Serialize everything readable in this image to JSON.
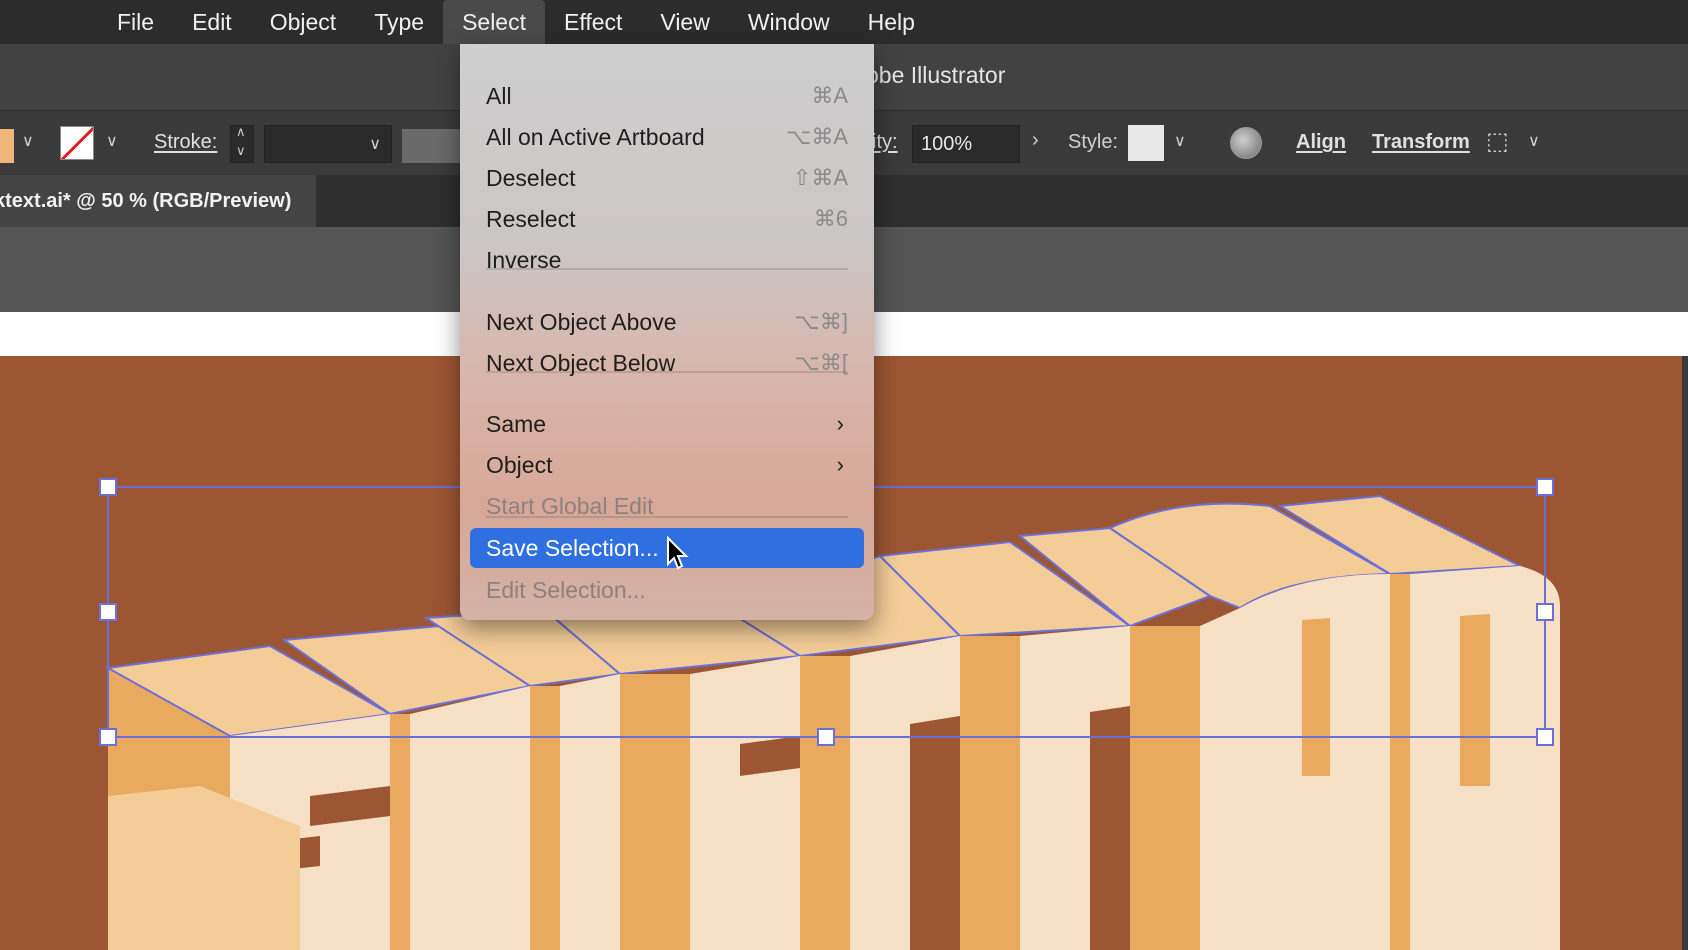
{
  "menubar": {
    "items": [
      "File",
      "Edit",
      "Object",
      "Type",
      "Select",
      "Effect",
      "View",
      "Window",
      "Help"
    ],
    "active": "Select"
  },
  "app": {
    "title": "obe Illustrator"
  },
  "controlbar": {
    "stroke_label": "Stroke:",
    "opacity_label": "ity:",
    "opacity_value": "100%",
    "style_label": "Style:",
    "align_label": "Align",
    "transform_label": "Transform"
  },
  "document": {
    "tab_title": "ktext.ai* @ 50 % (RGB/Preview)"
  },
  "select_menu": {
    "all": {
      "label": "All",
      "shortcut": "⌘A"
    },
    "all_on_artboard": {
      "label": "All on Active Artboard",
      "shortcut": "⌥⌘A"
    },
    "deselect": {
      "label": "Deselect",
      "shortcut": "⇧⌘A"
    },
    "reselect": {
      "label": "Reselect",
      "shortcut": "⌘6"
    },
    "inverse": {
      "label": "Inverse"
    },
    "next_above": {
      "label": "Next Object Above",
      "shortcut": "⌥⌘]"
    },
    "next_below": {
      "label": "Next Object Below",
      "shortcut": "⌥⌘["
    },
    "same": {
      "label": "Same"
    },
    "object": {
      "label": "Object"
    },
    "start_global_edit": {
      "label": "Start Global Edit"
    },
    "save_selection": {
      "label": "Save Selection..."
    },
    "edit_selection": {
      "label": "Edit Selection..."
    }
  },
  "colors": {
    "menubar_bg": "#2c2c2c",
    "artboard_bg": "#9c5634",
    "highlight": "#2f6fe0",
    "selection_box": "#6b6fd6",
    "letter_face": "#f6e1c6",
    "letter_top": "#f3cc98",
    "letter_side": "#e9a95e"
  },
  "icons": [
    "stroke-none-icon",
    "chevron-down-icon",
    "stepper-icon",
    "globe-icon",
    "chevron-right-icon",
    "pointer-cursor-icon"
  ]
}
